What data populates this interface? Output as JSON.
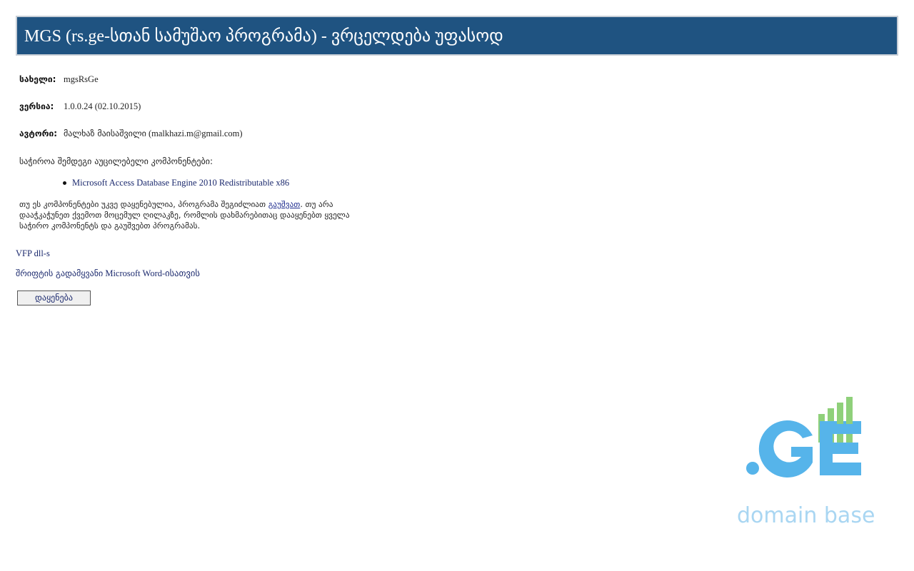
{
  "header": {
    "title": "MGS (rs.ge-სთან სამუშაო პროგრამა) - ვრცელდება უფასოდ"
  },
  "info": {
    "name_label": "სახელი:",
    "name_value": "mgsRsGe",
    "version_label": "ვერსია:",
    "version_value": "1.0.0.24 (02.10.2015)",
    "author_label": "ავტორი:",
    "author_name": "მალხაზ მაისაშვილი",
    "author_email": "(malkhazi.m@gmail.com)"
  },
  "requirements": {
    "intro": "საჭიროა შემდეგი აუცილებელი კომპონენტები:",
    "items": [
      "Microsoft Access Database Engine 2010 Redistributable x86"
    ]
  },
  "note": {
    "part1": "თუ ეს კომპონენტები უკვე დაყენებულია, პროგრამა შეგიძლიათ ",
    "link": "გაუშვათ",
    "part2": ". თუ არა დააჭკაჭუნეთ ქვემოთ მოცემულ ღილაკზე, რომლის დახმარებითაც დააყენებთ ყველა საჭირო კომპონენტს და გაუშვებთ პროგრამას."
  },
  "links": {
    "vfp": "VFP dll-s",
    "font_converter_geo": "შრიფტის გადამყვანი",
    "font_converter_rest": " Microsoft Word-ისათვის"
  },
  "install_button": "დაყენება",
  "logo": {
    "text": "domain base",
    "mark": ".GE",
    "colors": {
      "blue": "#56b4ea",
      "green": "#8fd07a",
      "light_text": "#a9d6f2"
    }
  },
  "colors": {
    "header_bg": "#1f5381",
    "link": "#1c2a6e"
  }
}
